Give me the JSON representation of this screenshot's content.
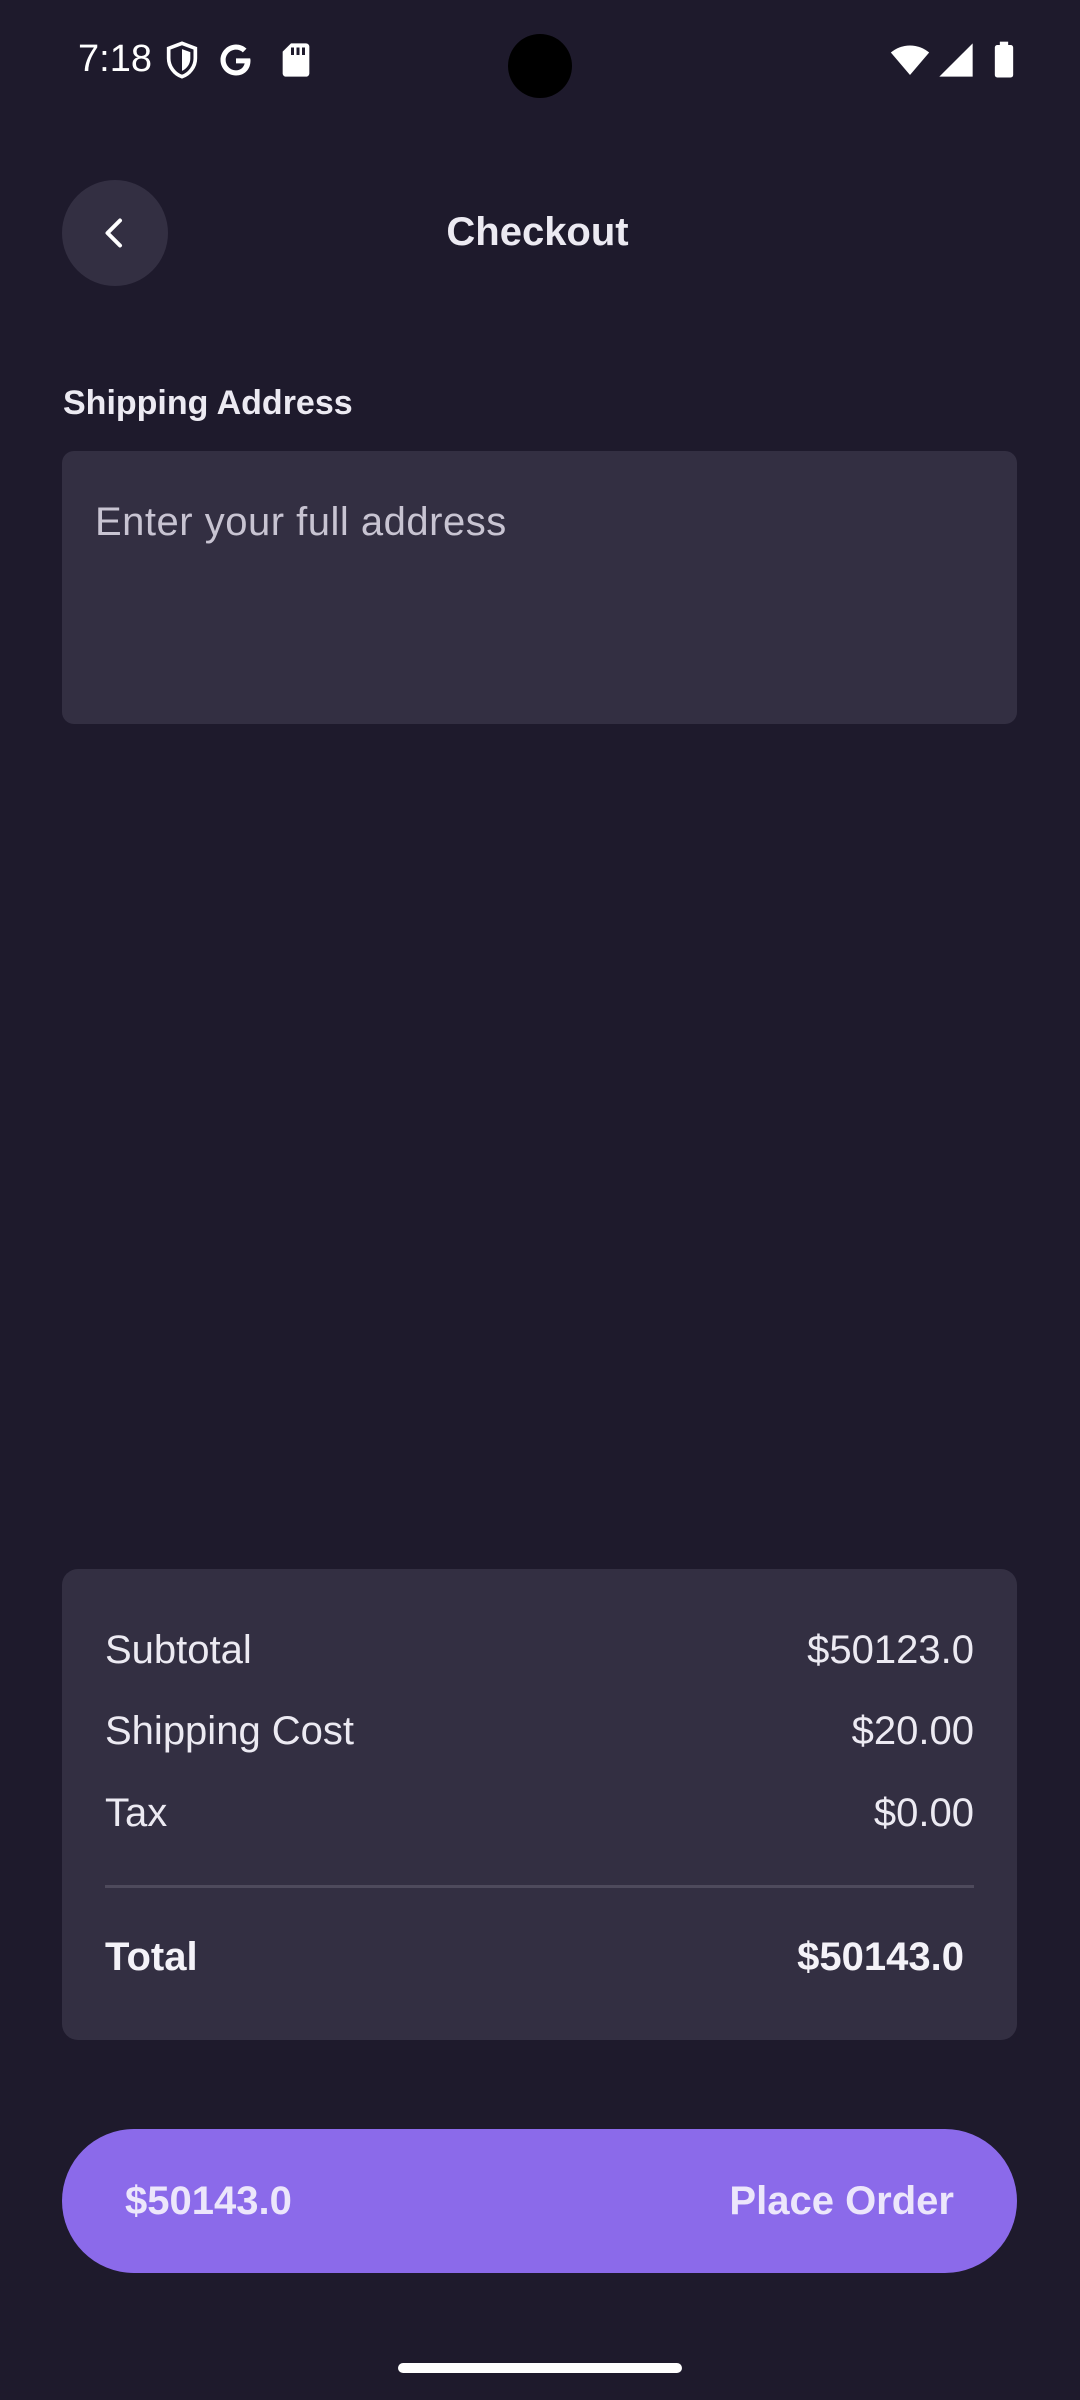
{
  "status_bar": {
    "time": "7:18",
    "icons": [
      "shield-icon",
      "google-icon",
      "sd-card-icon",
      "wifi-icon",
      "signal-icon",
      "battery-icon"
    ]
  },
  "header": {
    "title": "Checkout",
    "back_icon": "chevron-left-icon"
  },
  "shipping": {
    "label": "Shipping Address",
    "address_value": "",
    "address_placeholder": "Enter your full address"
  },
  "summary": {
    "rows": [
      {
        "label": "Subtotal",
        "value": "$50123.0"
      },
      {
        "label": "Shipping Cost",
        "value": "$20.00"
      },
      {
        "label": "Tax",
        "value": "$0.00"
      }
    ],
    "total": {
      "label": "Total",
      "value": "$50143.0"
    }
  },
  "place_order": {
    "amount": "$50143.0",
    "label": "Place Order"
  },
  "colors": {
    "background": "#1e1a2c",
    "surface": "#332f42",
    "accent": "#8b6aea",
    "text": "#eceaf2"
  }
}
